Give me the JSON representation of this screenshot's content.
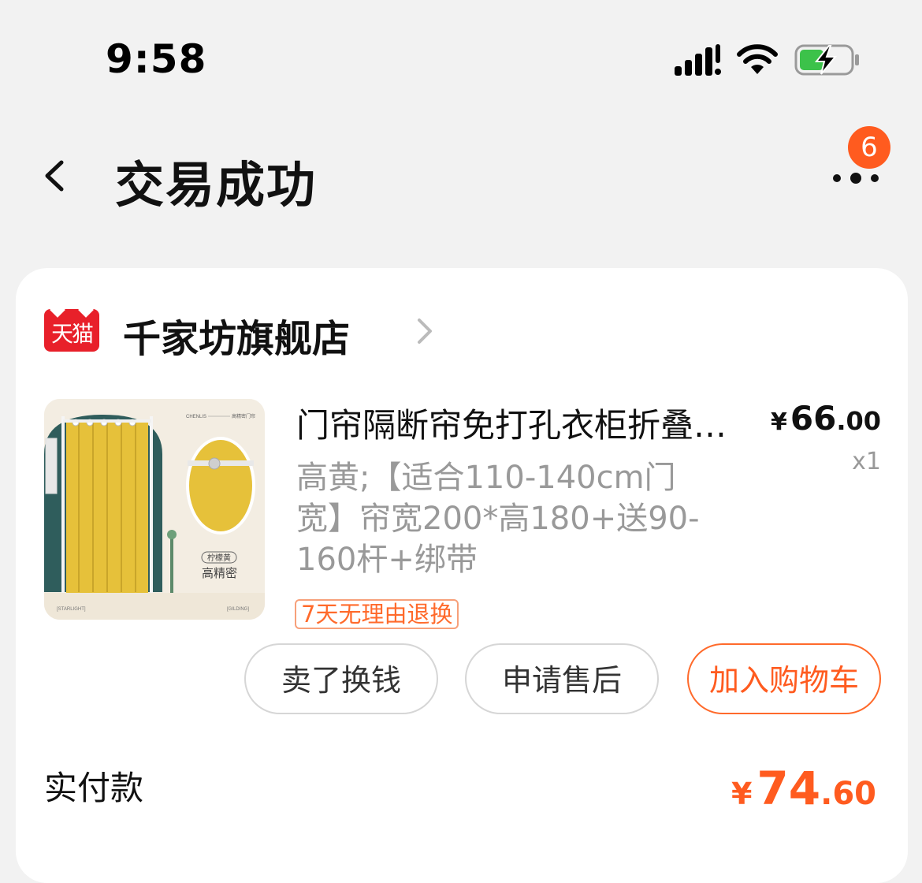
{
  "status_bar": {
    "time": "9:58"
  },
  "nav": {
    "title": "交易成功",
    "badge_count": "6"
  },
  "shop": {
    "logo_text": "天猫",
    "name": "千家坊旗舰店"
  },
  "product": {
    "title": "门帘隔断帘免打孔衣柜折叠门帘卧室遮挡布",
    "spec": "高黄;【适合110-140cm门宽】帘宽200*高180+送90-160杆+绑带",
    "price_currency": "¥",
    "price_integer": "66",
    "price_decimal": ".00",
    "quantity": "x1",
    "return_tag": "7天无理由退换",
    "image_texts": {
      "brand_top": "CHENLIS",
      "product_type": "高精密门帘",
      "color_tag": "柠檬黄",
      "quality": "高精密",
      "label_left": "[STARLIGHT]",
      "label_right": "[GILDING]"
    }
  },
  "actions": {
    "sell": "卖了换钱",
    "after_sales": "申请售后",
    "add_to_cart": "加入购物车"
  },
  "total": {
    "label": "实付款",
    "currency": "¥",
    "integer": "74",
    "decimal": ".60"
  },
  "colors": {
    "accent": "#ff5b1f",
    "tmall_red": "#e8202a",
    "curtain_yellow": "#e6c13a",
    "wall_teal": "#2f5d5c"
  }
}
